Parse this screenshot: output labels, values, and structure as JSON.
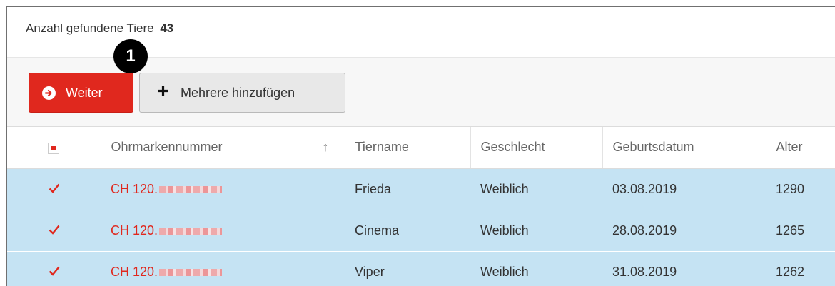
{
  "summary": {
    "label": "Anzahl gefundene Tiere",
    "count": "43"
  },
  "toolbar": {
    "weiter_label": "Weiter",
    "add_label": "Mehrere hinzufügen",
    "badge": "1"
  },
  "table": {
    "columns": [
      "Ohrmarkennummer",
      "Tiername",
      "Geschlecht",
      "Geburtsdatum",
      "Alter"
    ],
    "sort_icon": "↑",
    "rows": [
      {
        "checked": "✓",
        "ohrmarke": "CH 120.",
        "tiername": "Frieda",
        "geschlecht": "Weiblich",
        "geburtsdatum": "03.08.2019",
        "alter": "1290"
      },
      {
        "checked": "✓",
        "ohrmarke": "CH 120.",
        "tiername": "Cinema",
        "geschlecht": "Weiblich",
        "geburtsdatum": "28.08.2019",
        "alter": "1265"
      },
      {
        "checked": "✓",
        "ohrmarke": "CH 120.",
        "tiername": "Viper",
        "geschlecht": "Weiblich",
        "geburtsdatum": "31.08.2019",
        "alter": "1262"
      }
    ]
  },
  "colors": {
    "accent": "#e0281e",
    "row_selected": "#c5e3f3",
    "toolbar_bg": "#f7f7f7"
  }
}
